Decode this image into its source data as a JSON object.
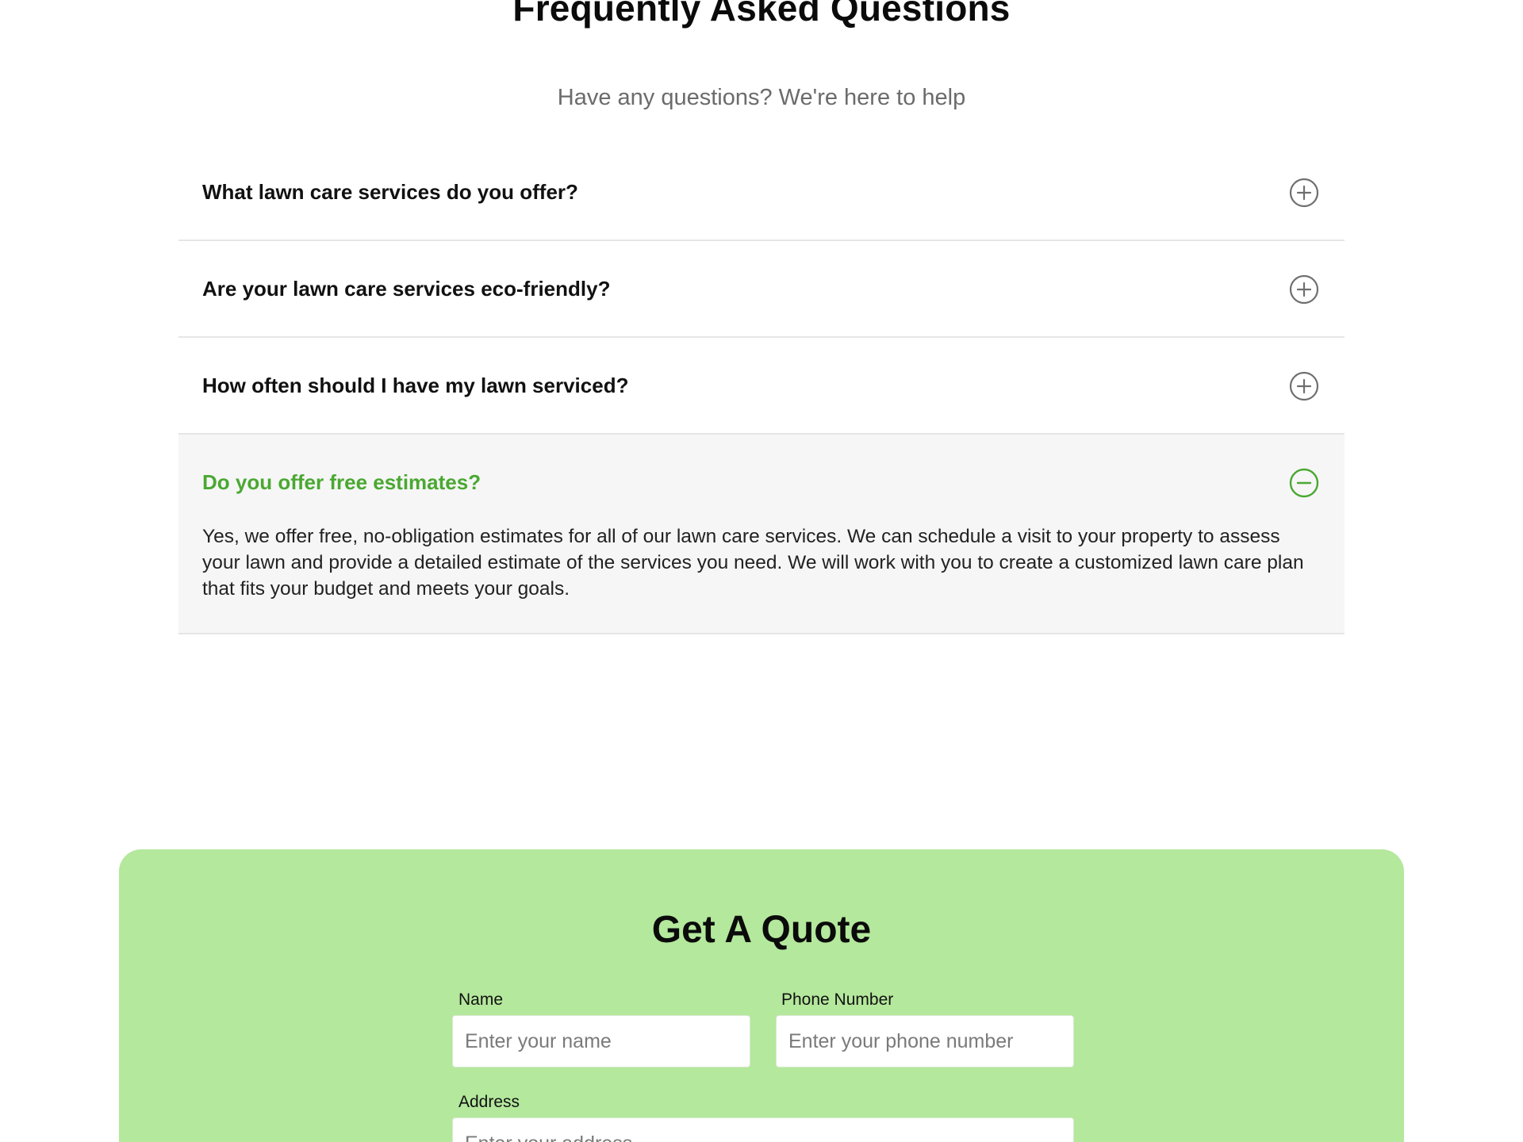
{
  "faq": {
    "title": "Frequently Asked Questions",
    "subtitle": "Have any questions? We're here to help",
    "items": [
      {
        "question": "What lawn care services do you offer?",
        "state": "collapsed",
        "icon": "plus-circle-icon"
      },
      {
        "question": "Are your lawn care services eco-friendly?",
        "state": "collapsed",
        "icon": "plus-circle-icon"
      },
      {
        "question": "How often should I have my lawn serviced?",
        "state": "collapsed",
        "icon": "plus-circle-icon"
      },
      {
        "question": "Do you offer free estimates?",
        "state": "expanded",
        "icon": "minus-circle-icon",
        "answer": "Yes, we offer free, no-obligation estimates for all of our lawn care services. We can schedule a visit to your property to assess your lawn and provide a detailed estimate of the services you need. We will work with you to create a customized lawn care plan that fits your budget and meets your goals."
      }
    ]
  },
  "quote": {
    "title": "Get A Quote",
    "name_label": "Name",
    "name_placeholder": "Enter your name",
    "phone_label": "Phone Number",
    "phone_placeholder": "Enter your phone number",
    "address_label": "Address",
    "address_placeholder": "Enter your address"
  },
  "colors": {
    "accent_green": "#4aa832",
    "quote_background": "#b4e89c",
    "icon_gray": "#6f6f6f",
    "divider": "#e6e6e6"
  }
}
